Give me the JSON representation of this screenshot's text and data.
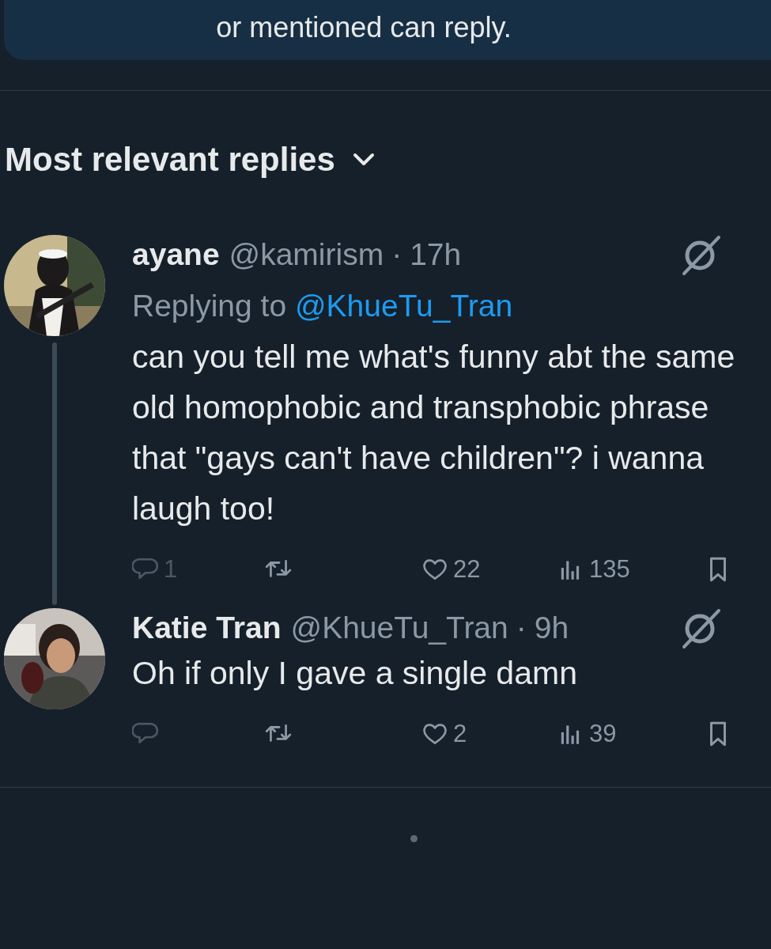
{
  "notice": {
    "text": "or mentioned can reply."
  },
  "replies_header": {
    "label": "Most relevant replies"
  },
  "tweets": [
    {
      "name": "ayane",
      "handle": "@kamirism",
      "separator": "·",
      "time": "17h",
      "replying_to": {
        "label": "Replying to",
        "handle": "@KhueTu_Tran"
      },
      "text": "can you tell me what's funny abt the same old homophobic and transphobic phrase that \"gays can't have children\"? i wanna laugh too!",
      "thread_line": true,
      "actions": [
        {
          "kind": "reply",
          "count": "1",
          "disabled": true
        },
        {
          "kind": "retweet",
          "disabled": false
        },
        {
          "kind": "like",
          "count": "22",
          "disabled": false
        },
        {
          "kind": "views",
          "count": "135",
          "disabled": false
        },
        {
          "kind": "bookmark",
          "disabled": false
        }
      ]
    },
    {
      "name": "Katie Tran",
      "handle": "@KhueTu_Tran",
      "separator": "·",
      "time": "9h",
      "text": "Oh if only I gave a single damn",
      "thread_line": false,
      "actions": [
        {
          "kind": "reply",
          "disabled": true
        },
        {
          "kind": "retweet",
          "disabled": false
        },
        {
          "kind": "like",
          "count": "2",
          "disabled": false
        },
        {
          "kind": "views",
          "count": "39",
          "disabled": false
        },
        {
          "kind": "bookmark",
          "disabled": false
        }
      ]
    }
  ]
}
